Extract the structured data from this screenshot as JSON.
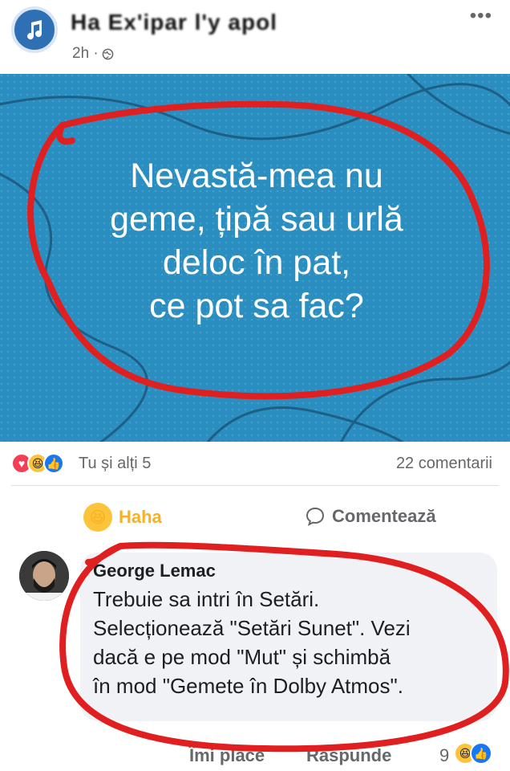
{
  "post": {
    "author": "Ha Ex'ipar l'y apol",
    "time": "2h ·",
    "more_icon": "•••",
    "text_lines": [
      "Nevastă-mea nu",
      "geme, țipă sau urlă",
      "deloc în pat,",
      "ce pot sa fac?"
    ]
  },
  "reactions": {
    "icons": [
      "love-icon",
      "haha-icon",
      "like-icon"
    ],
    "count_label": "Tu și alți 5",
    "comments_label": "22 comentarii"
  },
  "actions": {
    "haha_label": "Haha",
    "comment_label": "Comentează"
  },
  "comment": {
    "name": "George Lemac",
    "text_lines": [
      "Trebuie sa intri în Setări.",
      "Selecționează \"Setări Sunet\". Vezi",
      "dacă e pe mod \"Mut\" și schimbă",
      "în mod \"Gemete în Dolby Atmos\"."
    ],
    "like_label": "Îmi place",
    "reply_label": "Răspunde",
    "reaction_count": "9"
  },
  "colors": {
    "image_bg": "#2a8fc0",
    "annotation_red": "#e02020",
    "haha_yellow": "#f7b125"
  }
}
